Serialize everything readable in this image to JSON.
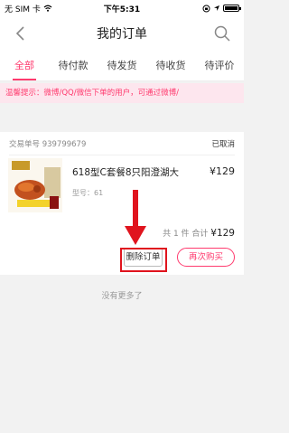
{
  "status_bar": {
    "carrier": "无 SIM 卡",
    "time": "下午5:31"
  },
  "nav": {
    "title": "我的订单",
    "back_icon": "chevron-left-icon",
    "search_icon": "search-icon"
  },
  "tabs": [
    {
      "label": "全部",
      "active": true
    },
    {
      "label": "待付款",
      "active": false
    },
    {
      "label": "待发货",
      "active": false
    },
    {
      "label": "待收货",
      "active": false
    },
    {
      "label": "待评价",
      "active": false
    }
  ],
  "notice": "温馨提示：微博/QQ/微信下单的用户，可通过微博/",
  "order": {
    "number_label": "交易单号 939799679",
    "status": "已取消",
    "product": {
      "title": "618型C套餐8只阳澄湖大",
      "price": "¥129",
      "spec": "型号：61"
    },
    "summary_count": "共 1 件  合计 ",
    "summary_amount": "¥129",
    "delete_label": "删除订单",
    "rebuy_label": "再次购买"
  },
  "footer_text": "没有更多了",
  "colors": {
    "accent": "#ff3a6e",
    "highlight": "#e0141e"
  }
}
